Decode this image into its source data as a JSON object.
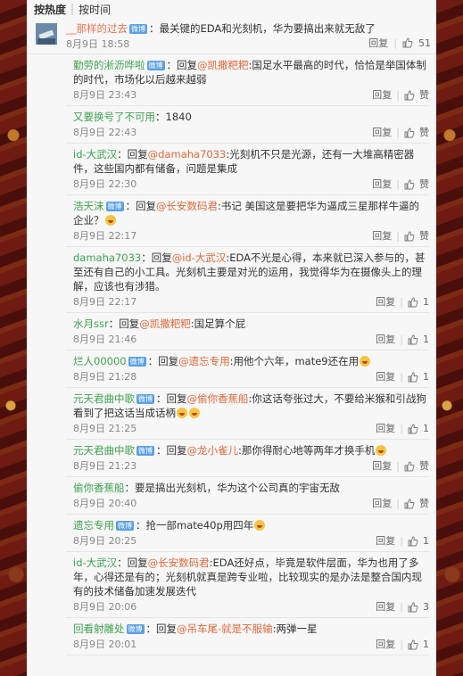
{
  "sort": {
    "hot": "按热度",
    "separator": "|",
    "time": "按时间"
  },
  "actions": {
    "reply": "回复",
    "like": "赞"
  },
  "main": {
    "user": "__那样的过去",
    "text": "：最关键的EDA和光刻机，华为要搞出来就无敌了",
    "time": "8月9日 18:58",
    "likes": "51"
  },
  "replies": [
    {
      "user": "勤劳的淅沥哗啦",
      "badge": true,
      "prefix": "：回复",
      "target": "@凯撒粑粑",
      "text": ":国足水平最高的时代，恰恰是举国体制的时代，市场化以后越来越弱",
      "time": "8月9日 23:43",
      "likes": "赞"
    },
    {
      "user": "又要换号了不可用",
      "badge": false,
      "prefix": "：1840",
      "target": "",
      "text": "",
      "time": "8月9日 22:43",
      "likes": "赞"
    },
    {
      "user": "id-大武汉",
      "badge": false,
      "prefix": "：回复",
      "target": "@damaha7033",
      "text": ":光刻机不只是光源，还有一大堆高精密器件，这些国内都有储备，问题是集成",
      "time": "8月9日 22:30",
      "likes": "赞"
    },
    {
      "user": "浩天沫",
      "badge": true,
      "prefix": "：回复",
      "target": "@长安数码君",
      "text": ":书记 美国这是要把华为逼成三星那样牛逼的企业？",
      "emoji": 1,
      "time": "8月9日 22:17",
      "likes": "赞"
    },
    {
      "user": "damaha7033",
      "badge": false,
      "prefix": "：回复",
      "target": "@id-大武汉",
      "text": ":EDA不光是心得，本来就已深入参与的，甚至还有自己的小工具。光刻机主要是对光的运用，我觉得华为在摄像头上的理解，应该也有涉猎。",
      "time": "8月9日 22:17",
      "likes": "1"
    },
    {
      "user": "水月ssr",
      "badge": false,
      "prefix": "：回复",
      "target": "@凯撒粑粑",
      "text": ":国足算个屁",
      "time": "8月9日 21:46",
      "likes": "1"
    },
    {
      "user": "烂人00000",
      "badge": true,
      "prefix": "：回复",
      "target": "@遗忘专用",
      "text": ":用他个六年，mate9还在用",
      "emoji": 1,
      "time": "8月9日 21:28",
      "likes": "1"
    },
    {
      "user": "元天君曲中歌",
      "badge": true,
      "prefix": "：回复",
      "target": "@偷你香蕉船",
      "text": ":你这话夸张过大，不要给米猴和引战狗看到了把这话当成话柄",
      "emoji": 2,
      "time": "8月9日 21:25",
      "likes": "1"
    },
    {
      "user": "元天君曲中歌",
      "badge": true,
      "prefix": "：回复",
      "target": "@龙小雀儿",
      "text": ":那你得耐心地等两年才换手机",
      "emoji": 1,
      "time": "8月9日 21:23",
      "likes": "赞"
    },
    {
      "user": "偷你香蕉船",
      "badge": false,
      "prefix": "：要是搞出光刻机，华为这个公司真的宇宙无敌",
      "target": "",
      "text": "",
      "time": "8月9日 20:40",
      "likes": "赞"
    },
    {
      "user": "遗忘专用",
      "badge": true,
      "prefix": "：抢一部mate40p用四年",
      "target": "",
      "text": "",
      "emoji": 1,
      "time": "8月9日 20:25",
      "likes": "1"
    },
    {
      "user": "id-大武汉",
      "badge": false,
      "prefix": "：回复",
      "target": "@长安数码君",
      "text": ":EDA还好点，毕竟是软件层面，华为也用了多年，心得还是有的；光刻机就真是跨专业啦，比较现实的是办法是整合国内现有的技术储备加速发展迭代",
      "time": "8月9日 20:06",
      "likes": "3"
    },
    {
      "user": "回看射雕处",
      "badge": true,
      "prefix": "：回复",
      "target": "@吊车尾-就是不服输",
      "text": ":两弹一星",
      "time": "8月9日 20:01",
      "likes": "1"
    }
  ],
  "colors": {
    "username": "#3ea34f",
    "link": "#e0683a",
    "badge": "#5aa0e6"
  }
}
